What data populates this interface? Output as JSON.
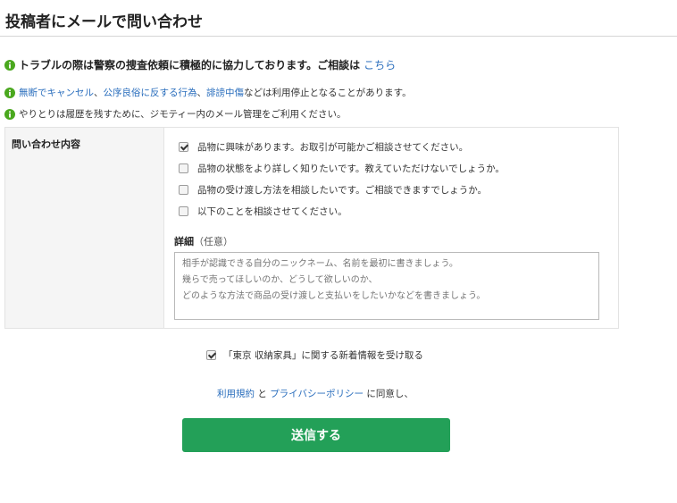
{
  "page": {
    "title": "投稿者にメールで問い合わせ"
  },
  "notices": {
    "trouble": {
      "text": "トラブルの際は警察の捜査依頼に積極的に協力しております。ご相談は",
      "link": "こちら"
    },
    "policy": {
      "link1": "無断でキャンセル",
      "sep1": "、",
      "link2": "公序良俗に反する行為",
      "sep2": "、",
      "link3": "誹謗中傷",
      "suffix": "などは利用停止となることがあります。"
    },
    "history": {
      "text": "やりとりは履歴を残すために、ジモティー内のメール管理をご利用ください。"
    }
  },
  "form": {
    "label": "問い合わせ内容",
    "options": [
      {
        "label": "品物に興味があります。お取引が可能かご相談させてください。",
        "checked": true
      },
      {
        "label": "品物の状態をより詳しく知りたいです。教えていただけないでしょうか。",
        "checked": false
      },
      {
        "label": "品物の受け渡し方法を相談したいです。ご相談できますでしょうか。",
        "checked": false
      },
      {
        "label": "以下のことを相談させてください。",
        "checked": false
      }
    ],
    "detail_label": "詳細",
    "detail_optional": "（任意）",
    "detail_placeholder": "相手が認識できる自分のニックネーム、名前を最初に書きましょう。\n幾らで売ってほしいのか、どうして欲しいのか、\nどのような方法で商品の受け渡しと支払いをしたいかなどを書きましょう。",
    "detail_value": ""
  },
  "subscribe": {
    "label": "「東京 収納家具」に関する新着情報を受け取る",
    "checked": true
  },
  "agreement": {
    "terms_link": "利用規約",
    "and": " と ",
    "privacy_link": "プライバシーポリシー",
    "suffix": " に同意し、"
  },
  "submit": {
    "label": "送信する"
  },
  "colors": {
    "info_icon": "#4aa81e",
    "link": "#2a6ebd",
    "submit_bg": "#23a058"
  },
  "icons": {
    "info": "info-circle-icon",
    "check": "checkmark-icon",
    "grip": "resize-grip-icon"
  }
}
